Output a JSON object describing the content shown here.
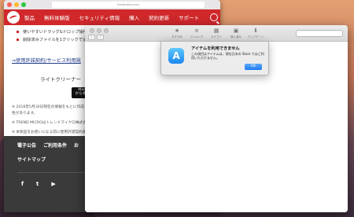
{
  "browser": {
    "address": "trendmicro.com",
    "nav": {
      "items": [
        "製品",
        "無料体験版",
        "セキュリティ情報",
        "購入",
        "契約更新",
        "サポート"
      ]
    },
    "content": {
      "bullets": [
        "使いやすいドラッグ&ドロップ操作",
        "削除済みファイルを1クリックで消去"
      ],
      "link": "⇒使用許諾契約/サービス利用規",
      "subtitle": "ライトクリーナー",
      "badge_line1": "Mac App",
      "badge_line2": "からダウンロ",
      "notes": [
        "※ 2016年5月30日現在の情報をもとに作成さ",
        "性があります。",
        "※ TREND MICROはトレンドマイクロ株式会",
        "※ 本製品をお使いになる前に使用許諾契約書"
      ]
    },
    "footer": {
      "links": [
        "電子公告",
        "ご利用条件",
        "お"
      ],
      "sitemap": "サイトマップ",
      "social": [
        "f",
        "t",
        "▶"
      ]
    }
  },
  "appstore": {
    "nav": {
      "back": "‹",
      "forward": "›"
    },
    "tabs": [
      {
        "icon": "★",
        "label": "おすすめ"
      },
      {
        "icon": "≡",
        "label": "ランキング"
      },
      {
        "icon": "▦",
        "label": "カテゴリ"
      },
      {
        "icon": "▣",
        "label": "購入済み"
      },
      {
        "icon": "⬇",
        "label": "アップデート"
      }
    ]
  },
  "alert": {
    "icon": "A",
    "title": "アイテムを利用できません",
    "message": "この項目はアイテムは、現在日本の Store ではご利用いただけません。",
    "ok_label": "OK"
  }
}
